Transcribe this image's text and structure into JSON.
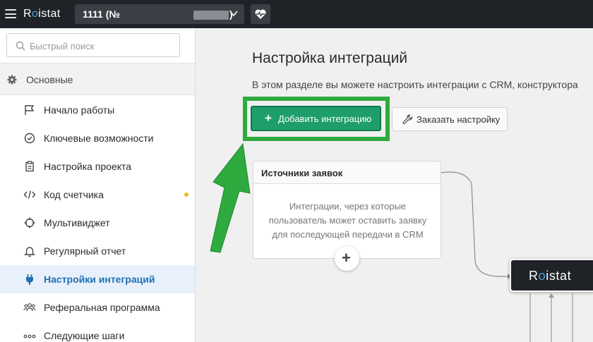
{
  "topbar": {
    "logo_pre": "R",
    "logo_o": "o",
    "logo_post": "istat",
    "project_label": "1111 (№",
    "project_suffix": ")"
  },
  "sidebar": {
    "search_placeholder": "Быстрый поиск",
    "section_label": "Основные",
    "items": [
      {
        "label": "Начало работы"
      },
      {
        "label": "Ключевые возможности"
      },
      {
        "label": "Настройка проекта"
      },
      {
        "label": "Код счетчика"
      },
      {
        "label": "Мультивиджет"
      },
      {
        "label": "Регулярный отчет"
      },
      {
        "label": "Настройки интеграций"
      },
      {
        "label": "Реферальная программа"
      },
      {
        "label": "Следующие шаги"
      }
    ]
  },
  "main": {
    "title": "Настройка интеграций",
    "description": "В этом разделе вы можете настроить интеграции с CRM, конструктора",
    "add_button": "Добавить интеграцию",
    "order_button": "Заказать настройку",
    "card": {
      "title": "Источники заявок",
      "text": "Интеграции, через которые пользователь может оставить заявку для последующей передачи в CRM"
    },
    "node": {
      "pre": "R",
      "o": "o",
      "post": "istat"
    }
  },
  "colors": {
    "topbar": "#1f2328",
    "accent": "#1e9e6b",
    "highlight": "#2eaa3e",
    "active_item": "#1f6fb5",
    "dot": "#f0b82b"
  }
}
